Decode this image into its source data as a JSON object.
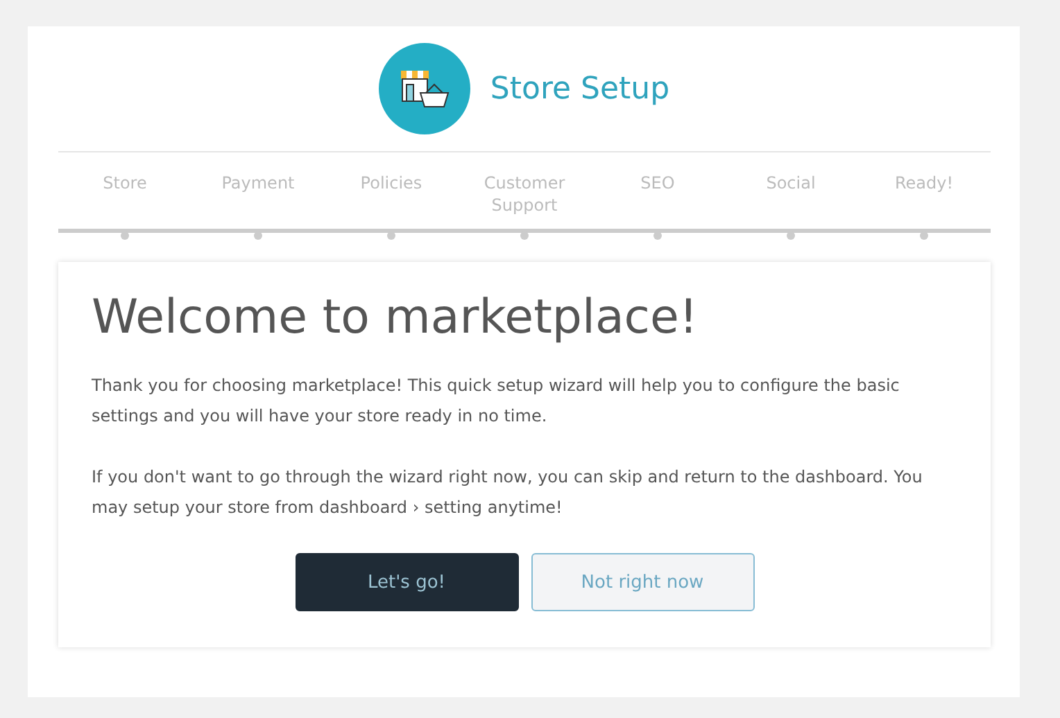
{
  "header": {
    "title": "Store Setup"
  },
  "steps": [
    {
      "label": "Store"
    },
    {
      "label": "Payment"
    },
    {
      "label": "Policies"
    },
    {
      "label": "Customer Support"
    },
    {
      "label": "SEO"
    },
    {
      "label": "Social"
    },
    {
      "label": "Ready!"
    }
  ],
  "card": {
    "heading": "Welcome to marketplace!",
    "paragraphs": [
      "Thank you for choosing marketplace! This quick setup wizard will help you to configure the basic settings and you will have your store ready in no time.",
      "If you don't want to go through the wizard right now, you can skip and return to the dashboard. You may setup your store from dashboard › setting anytime!"
    ],
    "buttons": [
      {
        "label": "Let's go!",
        "kind": "primary"
      },
      {
        "label": "Not right now",
        "kind": "secondary"
      }
    ]
  }
}
